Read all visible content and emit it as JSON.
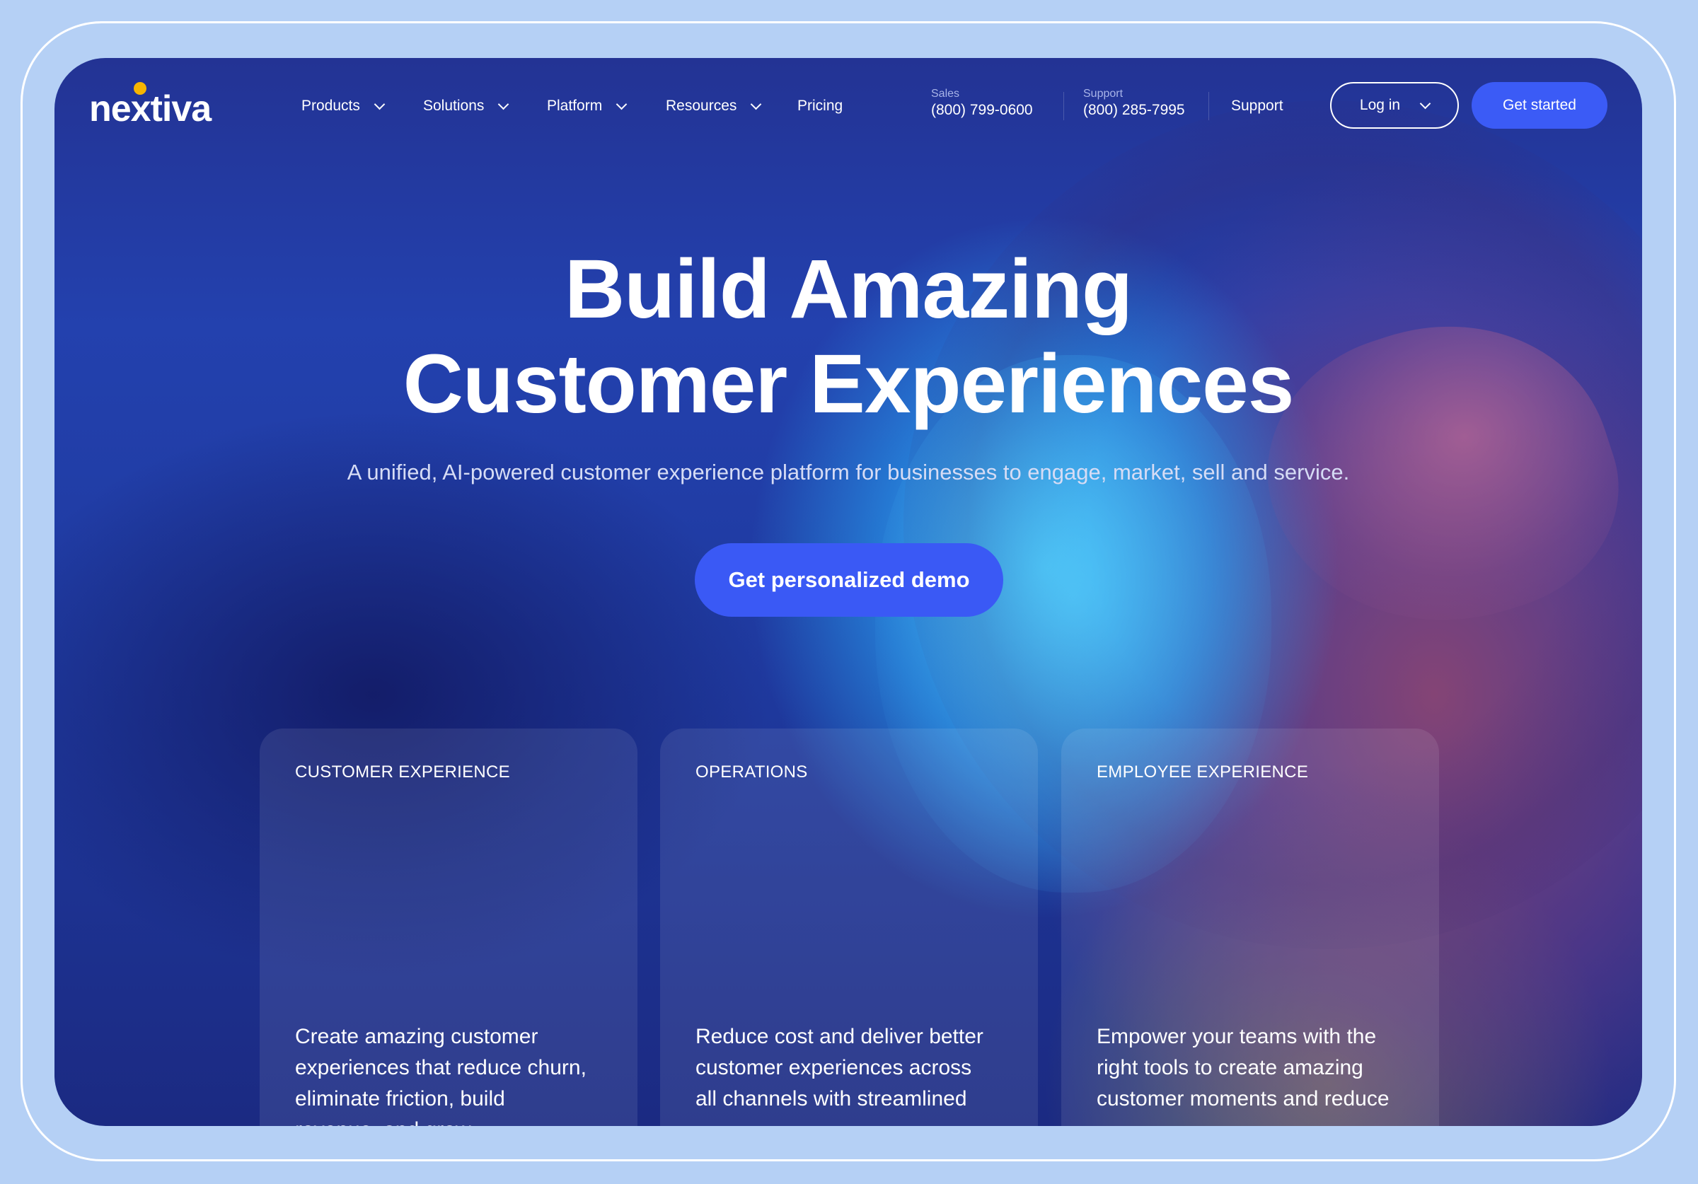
{
  "brand": {
    "name": "nextiva",
    "dot_color": "#f7b500"
  },
  "nav": {
    "items": [
      {
        "label": "Products",
        "has_dropdown": true
      },
      {
        "label": "Solutions",
        "has_dropdown": true
      },
      {
        "label": "Platform",
        "has_dropdown": true
      },
      {
        "label": "Resources",
        "has_dropdown": true
      },
      {
        "label": "Pricing",
        "has_dropdown": false
      }
    ],
    "sales": {
      "label": "Sales",
      "phone": "(800) 799-0600"
    },
    "support_phone": {
      "label": "Support",
      "phone": "(800) 285-7995"
    },
    "support_link": "Support",
    "login_label": "Log in",
    "get_started_label": "Get started"
  },
  "hero": {
    "title_line1": "Build Amazing",
    "title_line2": "Customer Experiences",
    "subtitle": "A unified, AI-powered customer experience platform for businesses to engage, market, sell and service.",
    "cta_label": "Get personalized demo"
  },
  "cards": [
    {
      "label": "CUSTOMER EXPERIENCE",
      "body": "Create amazing customer experiences that reduce churn, eliminate friction, build revenue, and grow"
    },
    {
      "label": "OPERATIONS",
      "body": "Reduce cost and deliver better customer experiences across all channels with streamlined"
    },
    {
      "label": "EMPLOYEE EXPERIENCE",
      "body": "Empower your teams with the right tools to create amazing customer moments and reduce"
    }
  ],
  "colors": {
    "accent": "#3b5bf6",
    "page_bg": "#b5d0f5",
    "hero_bg": "#2341ae"
  }
}
